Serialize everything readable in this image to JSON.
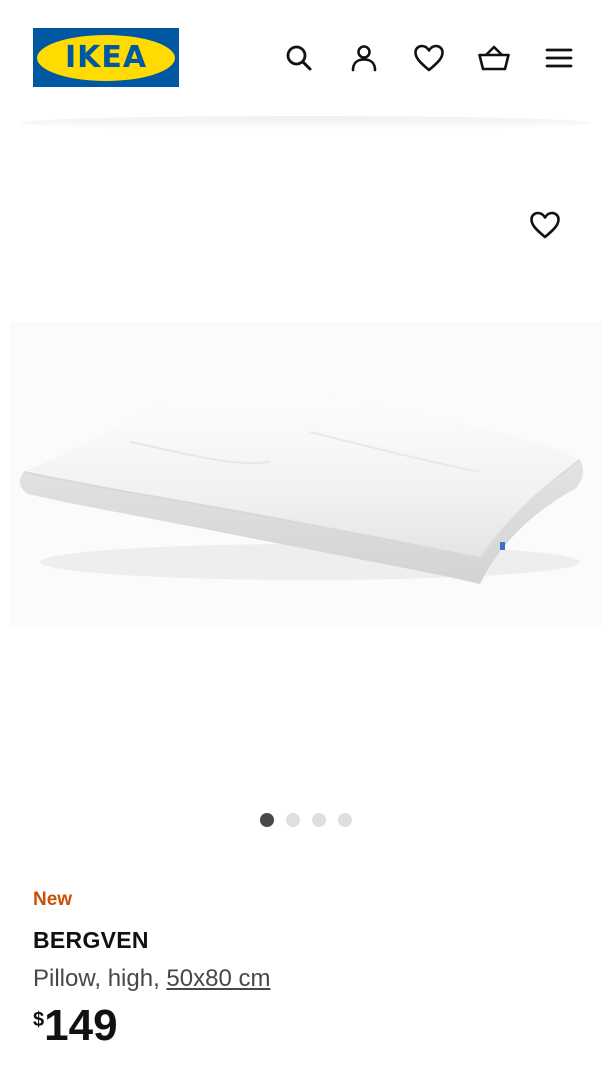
{
  "header": {
    "logo_text": "IKEA",
    "icons": [
      "search-icon",
      "account-icon",
      "favourites-icon",
      "basket-icon",
      "menu-icon"
    ]
  },
  "gallery": {
    "image_count": 4,
    "active_index": 0
  },
  "product": {
    "badge": "New",
    "name": "BERGVEN",
    "description_prefix": "Pillow, high, ",
    "size": "50x80 cm",
    "currency": "$",
    "price": "149"
  },
  "colors": {
    "brand_blue": "#0058a3",
    "brand_yellow": "#ffdb00",
    "new_badge": "#ca5008"
  }
}
